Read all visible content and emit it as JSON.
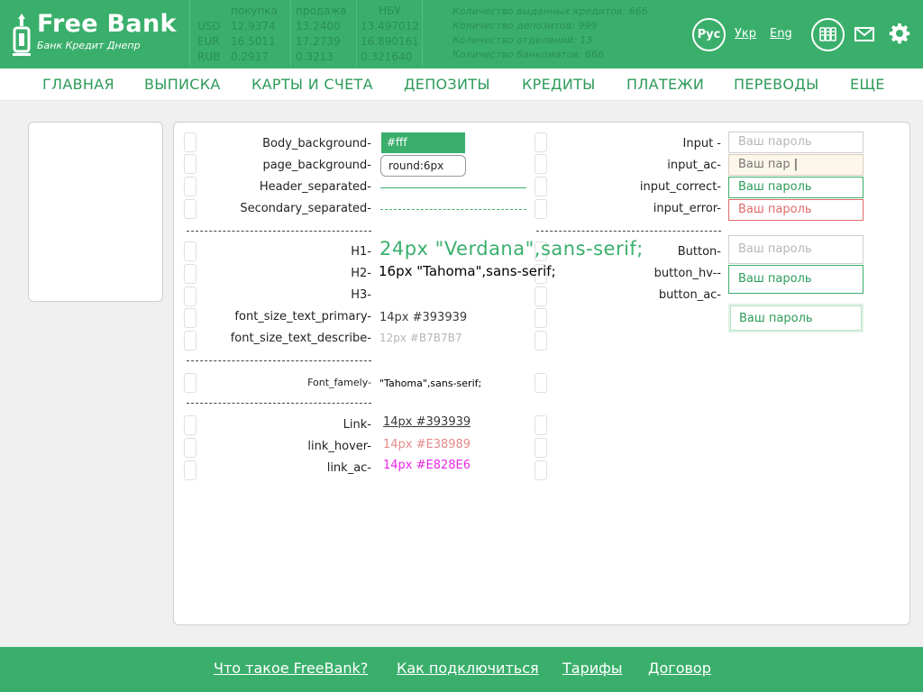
{
  "header": {
    "brand": "Free Bank",
    "brand_sub": "Банк Кредит Днепр",
    "rates": {
      "head_buy": "покупка",
      "head_sell": "продажа",
      "head_nbu": "НБУ",
      "currencies": [
        "USD",
        "EUR",
        "RUB"
      ],
      "buy": [
        "12.9374",
        "16.5011",
        "0.2917"
      ],
      "sell": [
        "13.2400",
        "17.2739",
        "0.3213"
      ],
      "nbu": [
        "13.497012",
        "16.890161",
        "0.321640"
      ]
    },
    "stats": [
      "Количество выданных кредитов: 666",
      "Количество депозитов: 999",
      "Количество отделений: 13",
      "Количество банкоматов: 666"
    ],
    "lang_active": "Рус",
    "lang_ukr": "Укр",
    "lang_eng": "Eng",
    "accent_color": "#3aaf6c"
  },
  "nav": [
    "ГЛАВНАЯ",
    "ВЫПИСКА",
    "КАРТЫ И СЧЕТА",
    "ДЕПОЗИТЫ",
    "КРЕДИТЫ",
    "ПЛАТЕЖИ",
    "ПЕРЕВОДЫ",
    "ЕЩЕ"
  ],
  "style": {
    "labels_left": {
      "body_background": "Body_background-",
      "page_background": "page_background-",
      "header_separated": "Header_separated-",
      "secondary_separated": "Secondary_separated-",
      "h1": "H1-",
      "h2": "H2-",
      "h3": "H3-",
      "font_size_text_primary": "font_size_text_primary-",
      "font_size_text_describe": "font_size_text_describe-",
      "font_famely": "Font_famely-",
      "link": "Link-",
      "link_hover": "link_hover-",
      "link_ac": "link_ac-"
    },
    "dashes": "------------------------------------------",
    "values": {
      "body_bg": "#fff",
      "round": "round:6px",
      "h1": "24px \"Verdana\",sans-serif;",
      "h2": "16px \"Tahoma\",sans-serif;",
      "primary": "14px #393939",
      "describe": "12px #B7B7B7",
      "font_famely": "\"Tahoma\",sans-serif;",
      "link": "14px #393939",
      "link_hover": "14px #E38989",
      "link_ac": "14px #E828E6"
    },
    "labels_right": {
      "input": "Input -",
      "input_ac": "input_ac-",
      "input_correct": "input_correct-",
      "input_error": "input_error-",
      "button": "Button-",
      "button_hv": "button_hv--",
      "button_ac": "button_ac-"
    },
    "input_placeholder": "Ваш пароль",
    "input_typed": "Ваш пар",
    "colors": {
      "link": "#393939",
      "link_hover": "#E38989",
      "link_ac": "#E828E6",
      "input_error": "#e06b6b",
      "input_ac_bg": "#fdf6ea"
    }
  },
  "footer": [
    "Что такое FreeBank?",
    "Как подключиться",
    "Тарифы",
    "Договор"
  ]
}
